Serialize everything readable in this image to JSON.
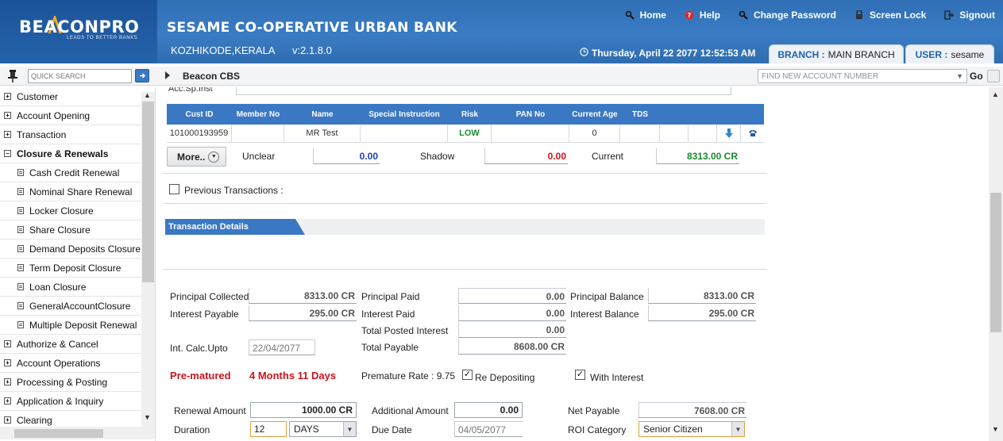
{
  "header": {
    "logo": "BEACONPRO",
    "logo_tagline": "LEADS TO BETTER BANKS",
    "bank_name": "SESAME CO-OPERATIVE URBAN BANK",
    "location": "KOZHIKODE,KERALA",
    "version": "v:2.1.8.0",
    "links": {
      "home": "Home",
      "help": "Help",
      "change_password": "Change Password",
      "screen_lock": "Screen Lock",
      "signout": "Signout"
    },
    "datetime": "Thursday, April 22 2077  12:52:53 AM",
    "branch_key": "BRANCH :",
    "branch_value": "MAIN BRANCH",
    "user_key": "USER :",
    "user_value": "sesame"
  },
  "toolbar": {
    "quick_search_placeholder": "QUICK SEARCH",
    "breadcrumb": "Beacon CBS",
    "account_search_placeholder": "FIND NEW ACCOUNT NUMBER",
    "go_label": "Go"
  },
  "sidebar": {
    "items": [
      {
        "label": "Customer",
        "type": "top"
      },
      {
        "label": "Account Opening",
        "type": "top"
      },
      {
        "label": "Transaction",
        "type": "top"
      },
      {
        "label": "Closure & Renewals",
        "type": "top-open"
      },
      {
        "label": "Cash Credit Renewal",
        "type": "sub"
      },
      {
        "label": "Nominal Share Renewal",
        "type": "sub"
      },
      {
        "label": "Locker Closure",
        "type": "sub"
      },
      {
        "label": "Share Closure",
        "type": "sub"
      },
      {
        "label": "Demand Deposits Closure",
        "type": "sub"
      },
      {
        "label": "Term Deposit Closure",
        "type": "sub"
      },
      {
        "label": "Loan Closure",
        "type": "sub"
      },
      {
        "label": "GeneralAccountClosure",
        "type": "sub"
      },
      {
        "label": "Multiple Deposit Renewal",
        "type": "sub"
      },
      {
        "label": "Authorize & Cancel",
        "type": "top"
      },
      {
        "label": "Account Operations",
        "type": "top"
      },
      {
        "label": "Processing & Posting",
        "type": "top"
      },
      {
        "label": "Application & Inquiry",
        "type": "top"
      },
      {
        "label": "Clearing",
        "type": "top"
      }
    ]
  },
  "main": {
    "cut_label": "Acc.Sp.Inst",
    "grid": {
      "headers": [
        "Cust ID",
        "Member No",
        "Name",
        "Special Instruction",
        "Risk",
        "PAN No",
        "Current Age",
        "TDS"
      ],
      "row": {
        "cust_id": "101000193959",
        "member_no": "",
        "name": "MR Test",
        "special_instruction": "",
        "risk": "LOW",
        "pan_no": "",
        "current_age": "0",
        "tds": ""
      }
    },
    "more_label": "More..",
    "unclear_label": "Unclear",
    "unclear_value": "0.00",
    "shadow_label": "Shadow",
    "shadow_value": "0.00",
    "current_label": "Current",
    "current_value": "8313.00 CR",
    "previous_transactions_label": "Previous Transactions :",
    "section_title": "Transaction Details",
    "details": {
      "principal_collected_label": "Principal Collected",
      "principal_collected": "8313.00 CR",
      "principal_paid_label": "Principal Paid",
      "principal_paid": "0.00",
      "principal_balance_label": "Principal Balance",
      "principal_balance": "8313.00 CR",
      "interest_payable_label": "Interest Payable",
      "interest_payable": "295.00 CR",
      "interest_paid_label": "Interest Paid",
      "interest_paid": "0.00",
      "interest_balance_label": "Interest Balance",
      "interest_balance": "295.00 CR",
      "total_posted_interest_label": "Total Posted Interest",
      "total_posted_interest": "0.00",
      "int_calc_upto_label": "Int. Calc.Upto",
      "int_calc_upto": "22/04/2077",
      "total_payable_label": "Total Payable",
      "total_payable": "8608.00 CR",
      "pre_matured_label": "Pre-matured",
      "pre_matured_period": "4 Months 11 Days",
      "premature_rate_label": "Premature Rate : 9.75",
      "re_depositing_label": "Re Depositing",
      "with_interest_label": "With Interest",
      "renewal_amount_label": "Renewal Amount",
      "renewal_amount": "1000.00 CR",
      "additional_amount_label": "Additional Amount",
      "additional_amount": "0.00",
      "net_payable_label": "Net Payable",
      "net_payable": "7608.00 CR",
      "duration_label": "Duration",
      "duration": "12",
      "duration_unit": "DAYS",
      "due_date_label": "Due Date",
      "due_date": "04/05/2077",
      "roi_category_label": "ROI Category",
      "roi_category": "Senior Citizen"
    }
  },
  "colors": {
    "header_blue": "#3a7cc4",
    "grid_blue": "#3b78c3",
    "positive_green": "#1c8b2e",
    "negative_red": "#d0121b",
    "link_blue": "#1d62b0"
  }
}
